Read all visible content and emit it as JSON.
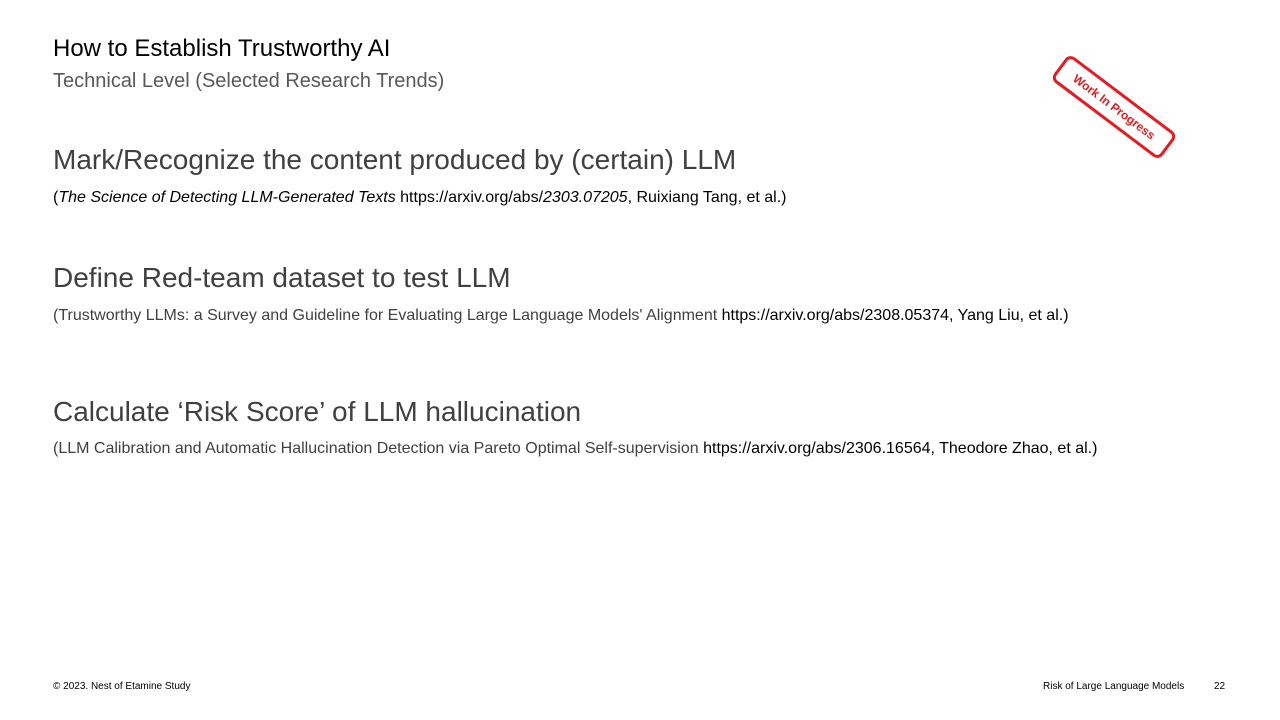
{
  "header": {
    "title": "How to Establish Trustworthy AI",
    "subtitle": "Technical Level (Selected Research Trends)"
  },
  "stamp": {
    "text": "Work In Progress",
    "color": "#e31b23"
  },
  "sections": [
    {
      "heading": "Mark/Recognize the content produced by (certain) LLM",
      "ref": {
        "open": "(",
        "paper_title": "The Science of Detecting LLM-Generated Texts",
        "url_prefix": " https://arxiv.org/abs/",
        "url_id": "2303.07205",
        "authors": ", Ruixiang Tang, et al.)"
      }
    },
    {
      "heading": "Define Red-team dataset to test LLM",
      "ref": {
        "paper_title": "(Trustworthy LLMs: a Survey and Guideline for Evaluating Large Language Models' Alignment",
        "url": " https://arxiv.org/abs/2308.05374",
        "authors": ", Yang Liu, et al.)"
      }
    },
    {
      "heading": "Calculate ‘Risk Score’ of  LLM hallucination",
      "ref": {
        "paper_title": "(LLM Calibration and Automatic Hallucination Detection via Pareto Optimal Self-supervision",
        "url": " https://arxiv.org/abs/2306.16564",
        "authors": ", Theodore Zhao, et al.)"
      }
    }
  ],
  "footer": {
    "copyright": "© 2023. Nest of Etamine Study",
    "deck_title": "Risk of Large Language Models",
    "page_number": "22"
  }
}
